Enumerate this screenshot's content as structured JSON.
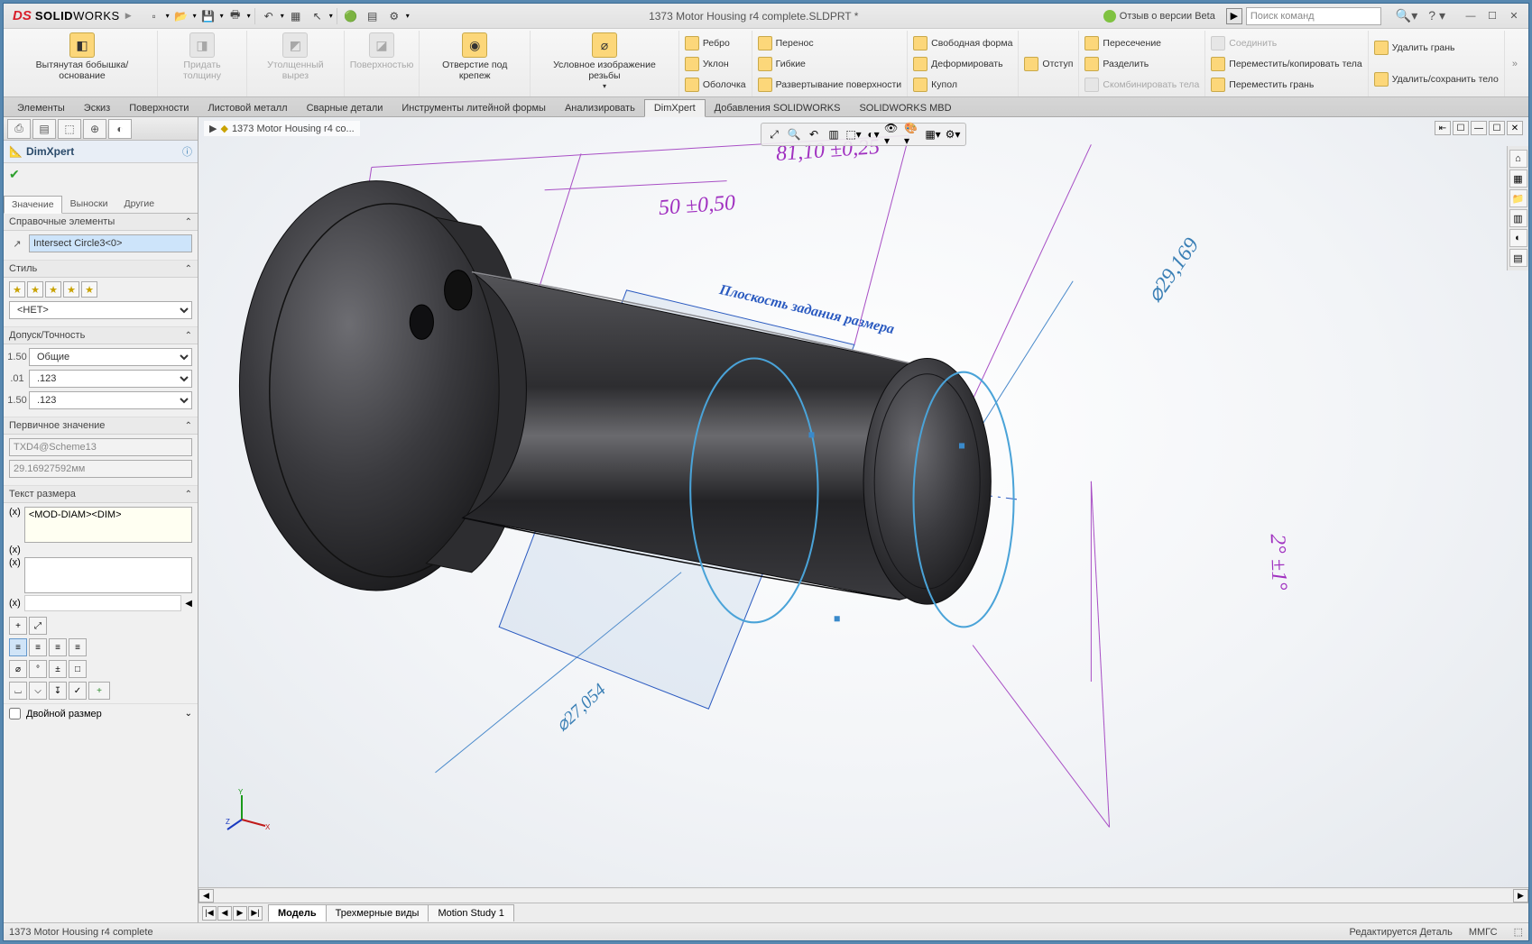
{
  "title": "1373 Motor Housing r4 complete.SLDPRT *",
  "logo": {
    "ds": "DS",
    "solid": "SOLID",
    "works": "WORKS"
  },
  "beta": "Отзыв о версии Beta",
  "search_placeholder": "Поиск команд",
  "ribbon": {
    "big": [
      {
        "label": "Вытянутая бобышка/основание",
        "disabled": false
      },
      {
        "label": "Придать толщину",
        "disabled": true
      },
      {
        "label": "Утолщенный вырез",
        "disabled": true
      },
      {
        "label": "Поверхностью",
        "disabled": true
      },
      {
        "label": "Отверстие под крепеж",
        "disabled": false
      },
      {
        "label": "Условное изображение резьбы",
        "disabled": false
      }
    ],
    "cols": [
      [
        {
          "l": "Ребро"
        },
        {
          "l": "Уклон"
        },
        {
          "l": "Оболочка"
        }
      ],
      [
        {
          "l": "Перенос"
        },
        {
          "l": "Гибкие"
        },
        {
          "l": "Развертывание поверхности"
        }
      ],
      [
        {
          "l": "Свободная форма"
        },
        {
          "l": "Деформировать"
        },
        {
          "l": "Купол"
        }
      ],
      [
        {
          "l": "Отступ"
        }
      ],
      [
        {
          "l": "Пересечение"
        },
        {
          "l": "Разделить"
        },
        {
          "l": "Скомбинировать тела",
          "d": true
        }
      ],
      [
        {
          "l": "Соединить",
          "d": true
        },
        {
          "l": "Переместить/копировать тела"
        },
        {
          "l": "Переместить грань"
        }
      ],
      [
        {
          "l": "Удалить грань"
        },
        {
          "l": "Удалить/сохранить тело"
        }
      ]
    ]
  },
  "tabs": [
    "Элементы",
    "Эскиз",
    "Поверхности",
    "Листовой металл",
    "Сварные детали",
    "Инструменты литейной формы",
    "Анализировать",
    "DimXpert",
    "Добавления SOLIDWORKS",
    "SOLIDWORKS MBD"
  ],
  "tabs_active": 7,
  "breadcrumb": "1373 Motor Housing r4 co...",
  "panel": {
    "title": "DimXpert",
    "subtabs": [
      "Значение",
      "Выноски",
      "Другие"
    ],
    "subtab_active": 0,
    "ref_section": "Справочные элементы",
    "ref_value": "Intersect Circle3<0>",
    "style_section": "Стиль",
    "style_select": "<НЕТ>",
    "tol_section": "Допуск/Точность",
    "tol_select": "Общие",
    "tol_prec1": ".123",
    "tol_prec2": ".123",
    "prim_section": "Первичное значение",
    "prim_name": "TXD4@Scheme13",
    "prim_val": "29.16927592мм",
    "dimtext_section": "Текст размера",
    "dimtext_val": "<MOD-DIAM><DIM>",
    "dual_label": "Двойной размер"
  },
  "viewport_dims": {
    "d1": "50 ±0,50",
    "d2": "81,10 ±0,25",
    "d3": "⌀29,169",
    "d4": "⌀27,054",
    "d5": "2° ±1°",
    "plane": "Плоскость задания размера"
  },
  "bottom_tabs": [
    "Модель",
    "Трехмерные виды",
    "Motion Study 1"
  ],
  "bottom_active": 0,
  "status": {
    "left": "1373 Motor Housing r4 complete",
    "r1": "Редактируется Деталь",
    "r2": "ММГС"
  }
}
